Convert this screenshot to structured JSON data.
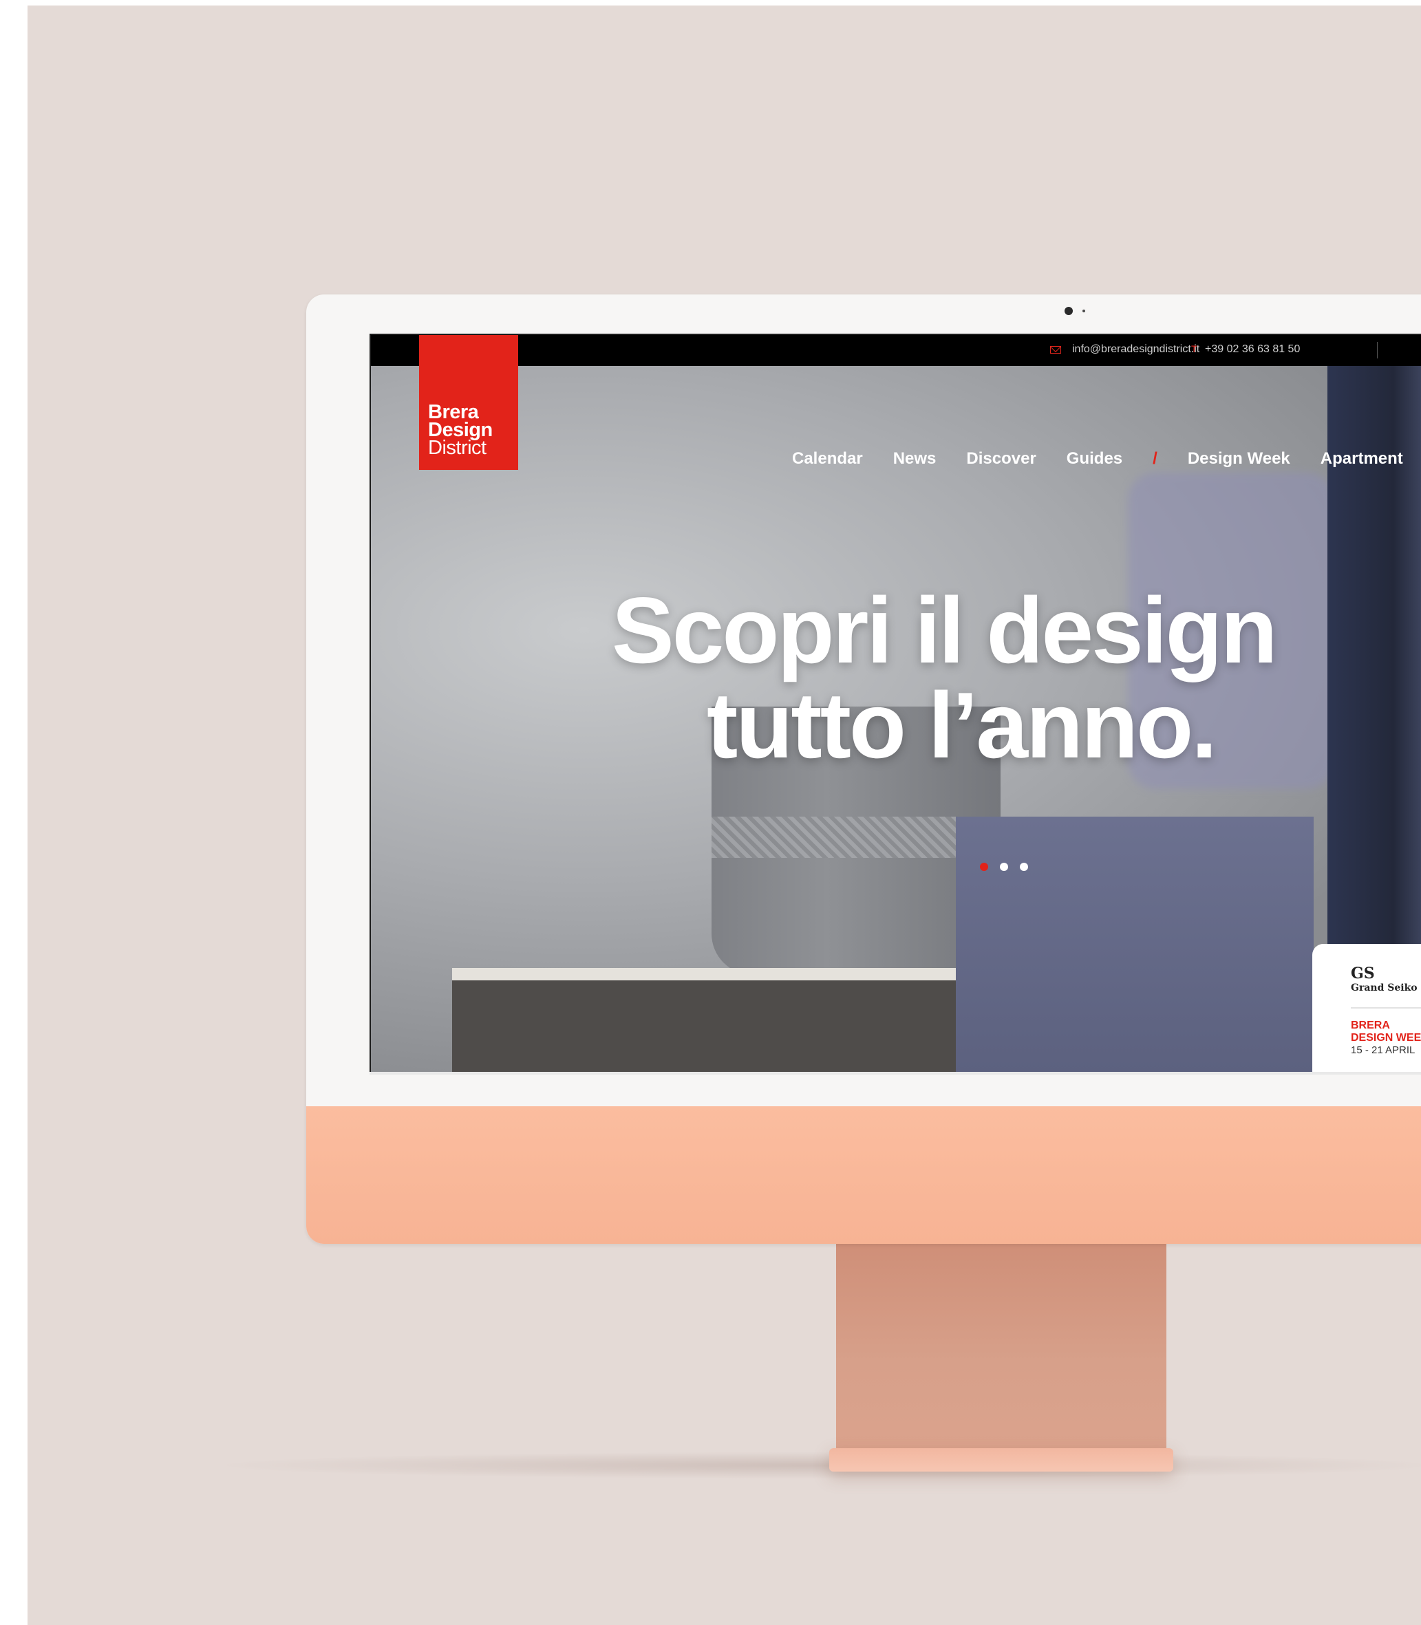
{
  "topbar": {
    "email": "info@breradesigndistrict.it",
    "phone_icon": "T",
    "phone": "+39 02 36 63 81 50"
  },
  "logo": {
    "line1": "Brera",
    "line2": "Design",
    "line3": "District"
  },
  "nav": {
    "items": [
      "Calendar",
      "News",
      "Discover",
      "Guides"
    ],
    "separator": "/",
    "secondary": [
      "Design Week",
      "Apartment"
    ]
  },
  "hero": {
    "line1": "Scopri il design",
    "line2": "tutto l’anno."
  },
  "slider": {
    "dot_count": 3,
    "active_index": 0
  },
  "promo": {
    "monogram": "GS",
    "brand": "Grand Seiko",
    "title_line1": "BRERA",
    "title_line2": "DESIGN WEEK",
    "dates": "15 - 21 APRIL"
  },
  "colors": {
    "brand_red": "#e2231a",
    "backdrop": "#e4dad6",
    "imac_peach": "#fbbd9f"
  }
}
